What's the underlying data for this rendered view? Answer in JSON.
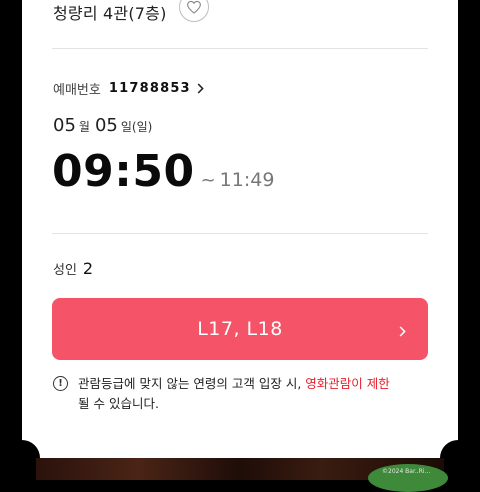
{
  "theater": {
    "name": "청량리 4관(7층)",
    "favorite_icon": "heart-outline-icon"
  },
  "booking": {
    "label": "예매번호",
    "number": "11788853",
    "chevron_icon": "chevron-right-icon"
  },
  "date": {
    "month": "05",
    "month_unit": "월",
    "day": "05",
    "day_unit": "일",
    "weekday": "(일)"
  },
  "time": {
    "start": "09:50",
    "separator": "~",
    "end": "11:49"
  },
  "people": {
    "label": "성인",
    "count": "2"
  },
  "seats": {
    "label": "L17, L18",
    "chevron_icon": "chevron-right-icon",
    "color": "#f55468"
  },
  "notice": {
    "icon": "exclamation-circle-icon",
    "icon_glyph": "!",
    "text_before": "관람등급에 맞지 않는 연령의 고객 입장 시, ",
    "text_warning": "영화관람이 제한",
    "text_after": "될 수 있습니다.",
    "warning_color": "#e8202a"
  },
  "poster": {
    "copyright": "©2024 Bar..Ri..."
  }
}
